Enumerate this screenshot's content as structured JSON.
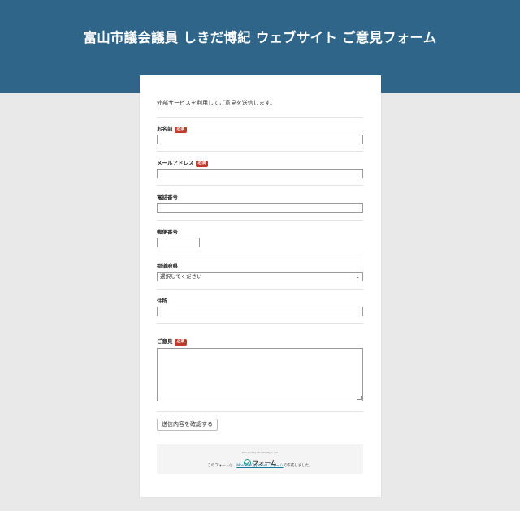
{
  "header": {
    "title": "富山市議会議員 しきだ博紀 ウェブサイト ご意見フォーム"
  },
  "form": {
    "intro": "外部サービスを利用してご意見を送信します。",
    "required_badge": "必須",
    "fields": {
      "name": {
        "label": "お名前",
        "value": ""
      },
      "email": {
        "label": "メールアドレス",
        "value": ""
      },
      "phone": {
        "label": "電話番号",
        "value": ""
      },
      "postal": {
        "label": "郵便番号",
        "value": ""
      },
      "prefecture": {
        "label": "都道府県",
        "selected": "選択してください"
      },
      "address": {
        "label": "住所",
        "value": ""
      },
      "opinion": {
        "label": "ご意見",
        "value": ""
      }
    },
    "confirm_button": "送信内容を確認する"
  },
  "footer": {
    "brand_small": "Powered by MovableType.net",
    "brand_name": "フォーム",
    "credit_prefix": "このフォームは、",
    "credit_link": "MovableType.net フォーム",
    "credit_suffix": "で作成しました。"
  },
  "colors": {
    "header_bg": "#2f6589",
    "page_bg": "#e9e9e9",
    "required_badge": "#c0392b",
    "brand_accent": "#1a9c8c"
  },
  "icons": {
    "select_arrow": "chevron-down-icon",
    "brand_logo": "check-circle-icon"
  }
}
